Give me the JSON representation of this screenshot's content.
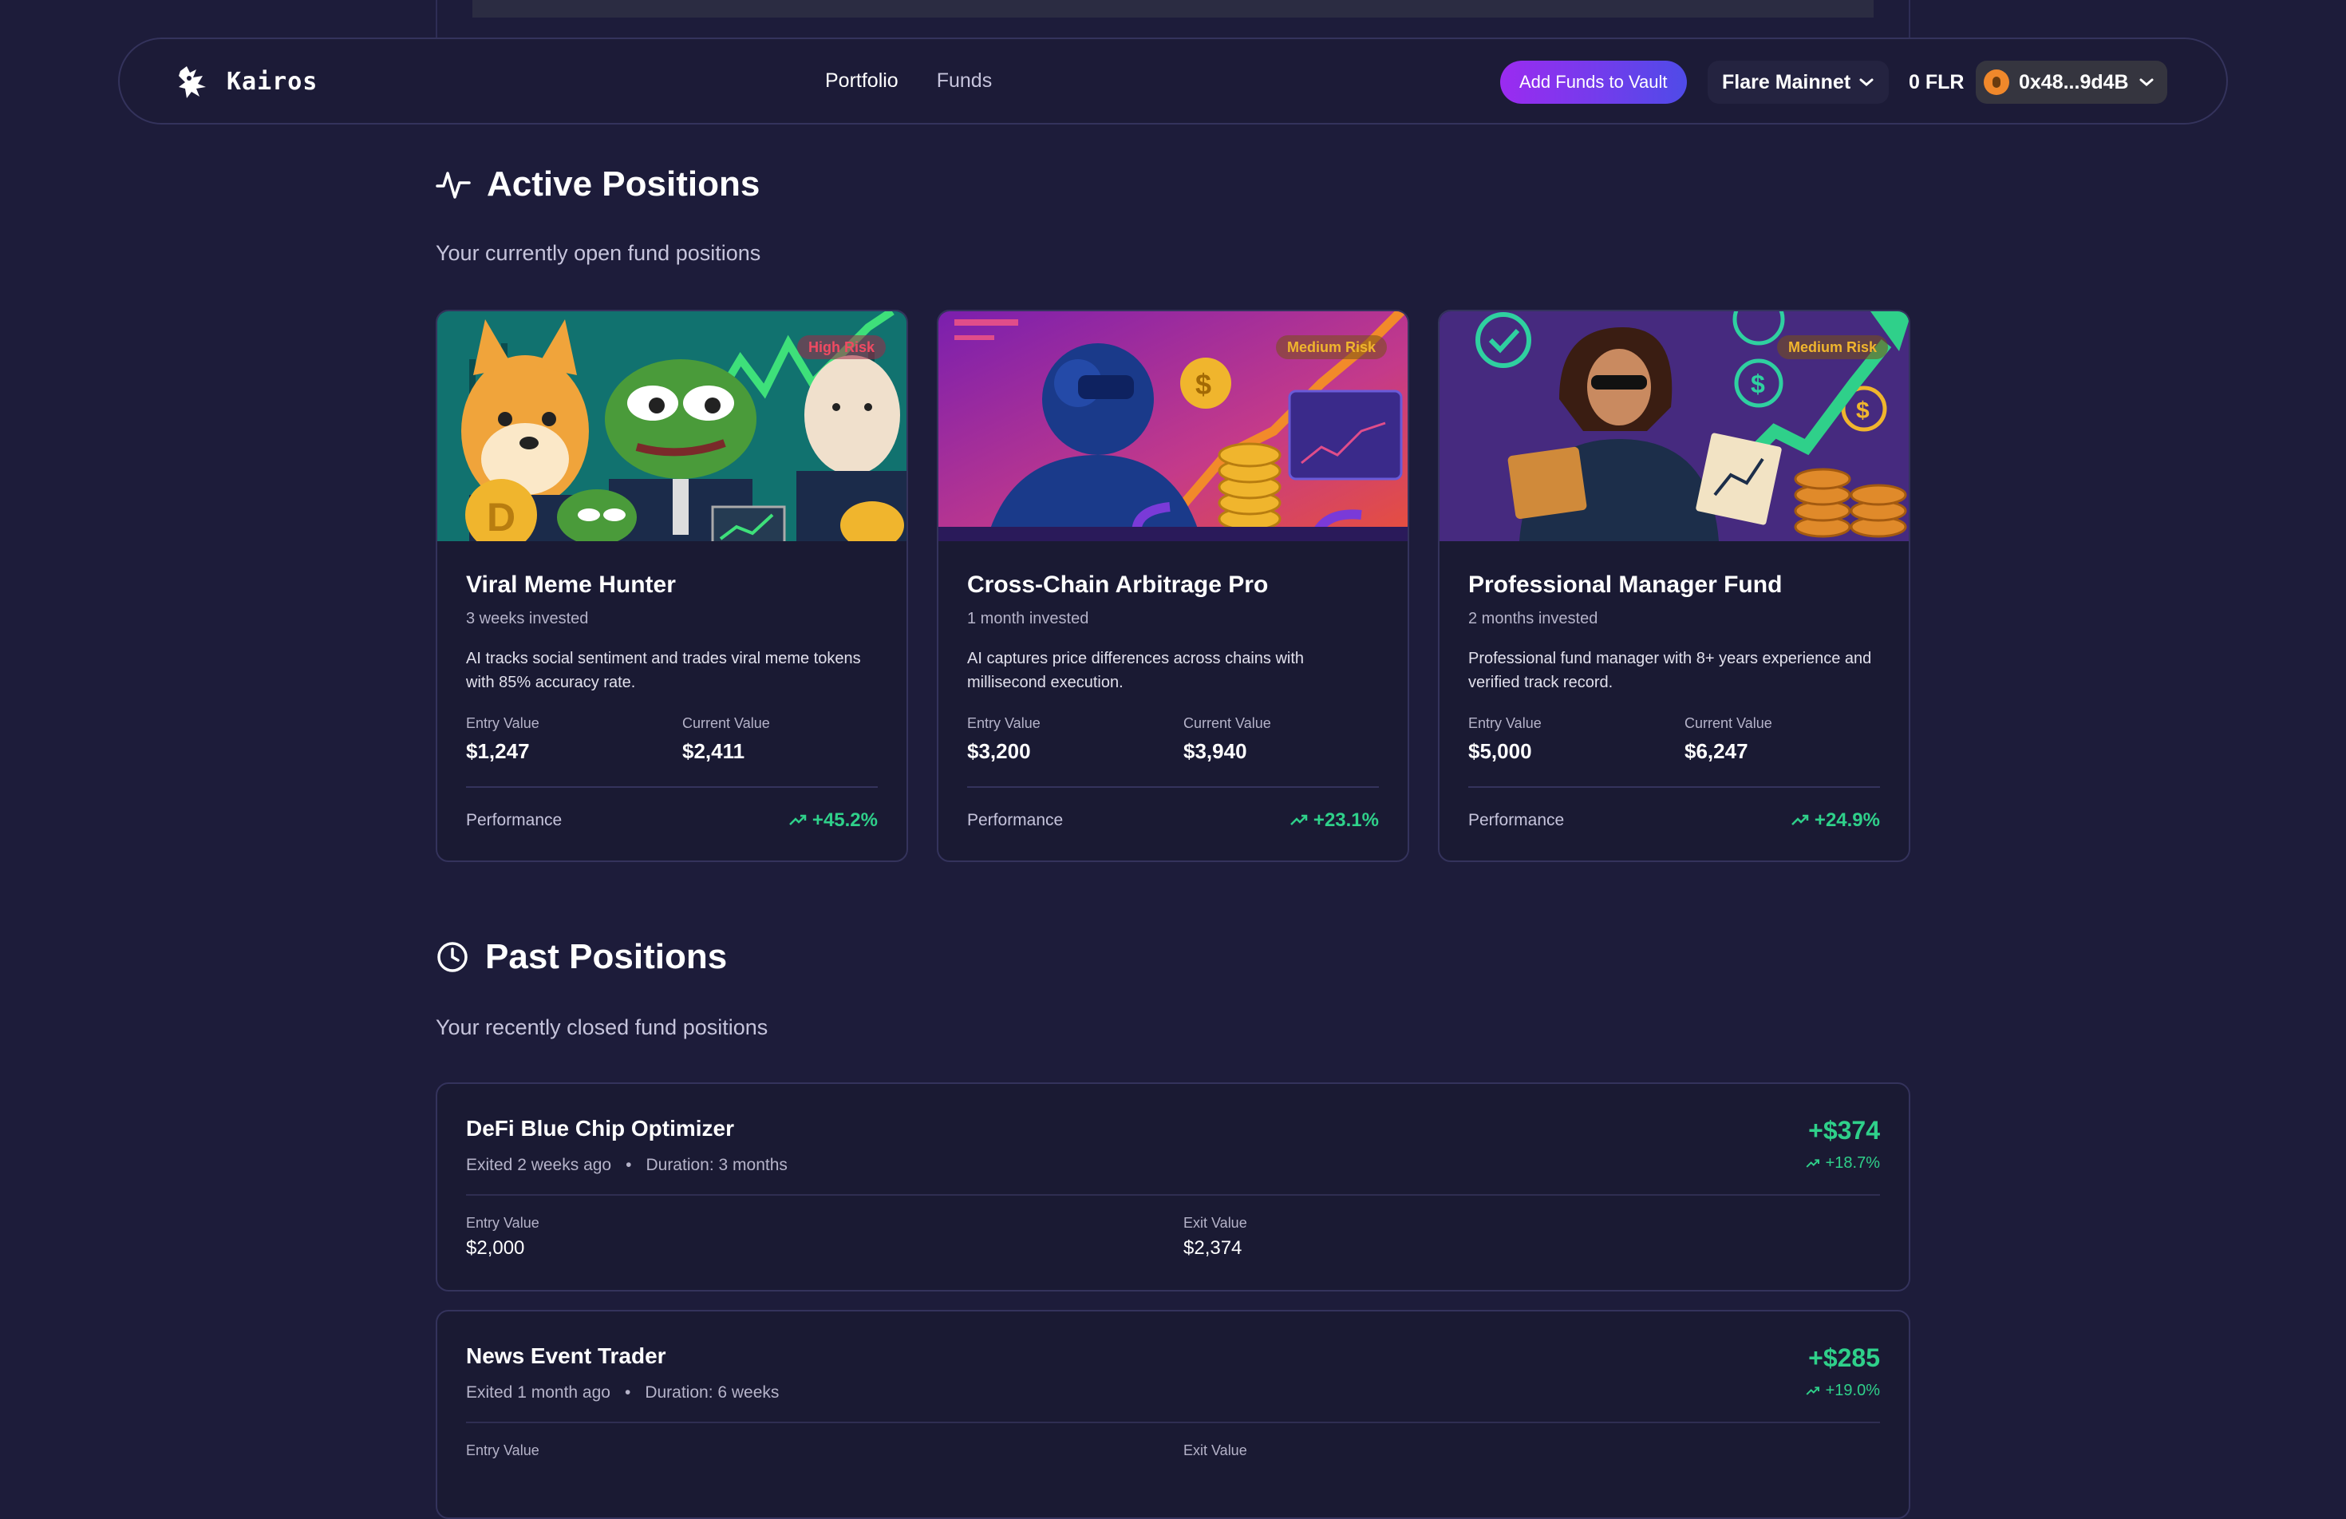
{
  "header": {
    "brand": "Kairos",
    "nav": [
      "Portfolio",
      "Funds"
    ],
    "add_funds": "Add Funds to Vault",
    "network": "Flare Mainnet",
    "balance": "0 FLR",
    "wallet": "0x48...9d4B"
  },
  "active": {
    "title": "Active Positions",
    "subtitle": "Your currently open fund positions",
    "entry_label": "Entry Value",
    "current_label": "Current Value",
    "performance_label": "Performance",
    "cards": [
      {
        "name": "Viral Meme Hunter",
        "invested": "3 weeks invested",
        "desc": "AI tracks social sentiment and trades viral meme tokens with 85% accuracy rate.",
        "risk": "High Risk",
        "entry": "$1,247",
        "current": "$2,411",
        "perf": "+45.2%"
      },
      {
        "name": "Cross-Chain Arbitrage Pro",
        "invested": "1 month invested",
        "desc": "AI captures price differences across chains with millisecond execution.",
        "risk": "Medium Risk",
        "entry": "$3,200",
        "current": "$3,940",
        "perf": "+23.1%"
      },
      {
        "name": "Professional Manager Fund",
        "invested": "2 months invested",
        "desc": "Professional fund manager with 8+ years experience and verified track record.",
        "risk": "Medium Risk",
        "entry": "$5,000",
        "current": "$6,247",
        "perf": "+24.9%"
      }
    ]
  },
  "past": {
    "title": "Past Positions",
    "subtitle": "Your recently closed fund positions",
    "entry_label": "Entry Value",
    "exit_label": "Exit Value",
    "dot": "•",
    "items": [
      {
        "name": "DeFi Blue Chip Optimizer",
        "exited": "Exited 2 weeks ago",
        "duration": "Duration: 3 months",
        "profit": "+$374",
        "pct": "+18.7%",
        "entry": "$2,000",
        "exit": "$2,374"
      },
      {
        "name": "News Event Trader",
        "exited": "Exited 1 month ago",
        "duration": "Duration: 6 weeks",
        "profit": "+$285",
        "pct": "+19.0%",
        "entry": "",
        "exit": ""
      }
    ]
  },
  "colors": {
    "background": "#1d1c3a",
    "positive": "#2fd08a",
    "accent_start": "#9b2bf0",
    "accent_end": "#4f4be8"
  }
}
